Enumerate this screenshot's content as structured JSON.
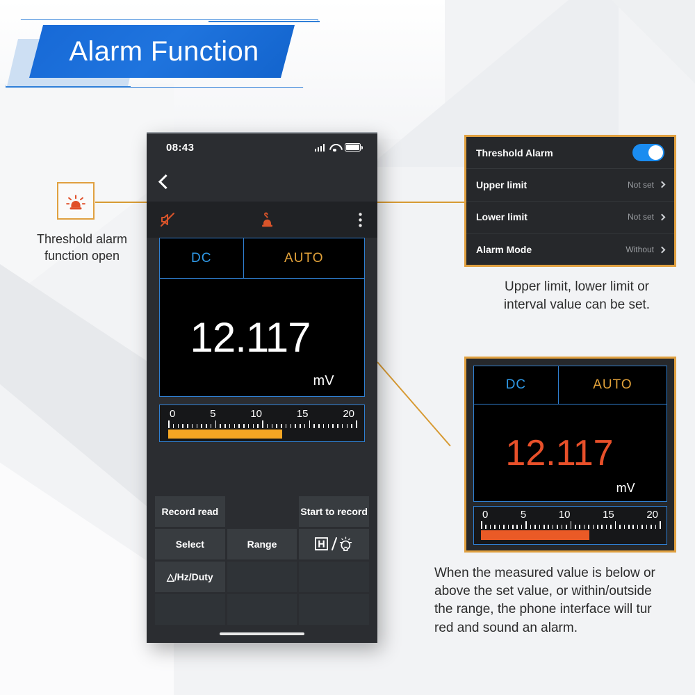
{
  "banner": {
    "title": "Alarm Function"
  },
  "left_callout": {
    "icon": "alarm-beacon-icon",
    "caption_line1": "Threshold alarm",
    "caption_line2": "function open"
  },
  "phone": {
    "status_bar": {
      "time": "08:43",
      "icons": [
        "signal-icon",
        "wifi-icon",
        "battery-icon"
      ]
    },
    "nav": {
      "back_icon": "back-chevron-icon"
    },
    "toolbar": {
      "mute_icon": "speaker-mute-icon",
      "alarm_icon": "alarm-beacon-icon",
      "menu_icon": "more-vertical-icon"
    },
    "meter": {
      "mode": "DC",
      "range_mode": "AUTO",
      "value": "12.117",
      "unit": "mV",
      "value_color": "#ffffff"
    },
    "scale": {
      "labels": [
        "0",
        "5",
        "10",
        "15",
        "20"
      ],
      "min": 0,
      "max": 20,
      "fill_value": 12.117,
      "fill_color": "#f5a623"
    },
    "buttons": [
      {
        "label": "Record read",
        "state": "active"
      },
      {
        "label": "",
        "state": "blank"
      },
      {
        "label": "Start to record",
        "state": "active"
      },
      {
        "label": "Select",
        "state": "active"
      },
      {
        "label": "Range",
        "state": "active"
      },
      {
        "label": "H / ☀",
        "state": "active",
        "icon": "hold-backlight-icon"
      },
      {
        "label": "△/Hz/Duty",
        "state": "active"
      },
      {
        "label": "",
        "state": "empty"
      },
      {
        "label": "",
        "state": "empty"
      },
      {
        "label": "",
        "state": "empty"
      },
      {
        "label": "",
        "state": "empty"
      },
      {
        "label": "",
        "state": "empty"
      }
    ]
  },
  "settings_panel": {
    "rows": [
      {
        "label": "Threshold Alarm",
        "control": "toggle",
        "value": "on"
      },
      {
        "label": "Upper limit",
        "control": "chevron",
        "value": "Not set"
      },
      {
        "label": "Lower limit",
        "control": "chevron",
        "value": "Not set"
      },
      {
        "label": "Alarm Mode",
        "control": "chevron",
        "value": "Without"
      }
    ]
  },
  "mid_caption": {
    "line1": "Upper limit, lower limit or",
    "line2": "interval value can be set."
  },
  "alarm_panel": {
    "mode": "DC",
    "range_mode": "AUTO",
    "value": "12.117",
    "unit": "mV",
    "value_color": "#e8502a",
    "scale": {
      "labels": [
        "0",
        "5",
        "10",
        "15",
        "20"
      ],
      "min": 0,
      "max": 20,
      "fill_value": 12.117,
      "fill_color": "#ea5a26"
    }
  },
  "bottom_caption": {
    "line1": "When the measured value is below or",
    "line2": "above the set value, or within/outside",
    "line3": "the range, the phone interface will tur",
    "line4": "red and sound an alarm."
  },
  "colors": {
    "brand_blue": "#1769d6",
    "accent_orange": "#e0a040",
    "meter_border": "#2f7fd1",
    "alarm_red": "#e8502a",
    "toggle_on": "#1a8cf0"
  }
}
